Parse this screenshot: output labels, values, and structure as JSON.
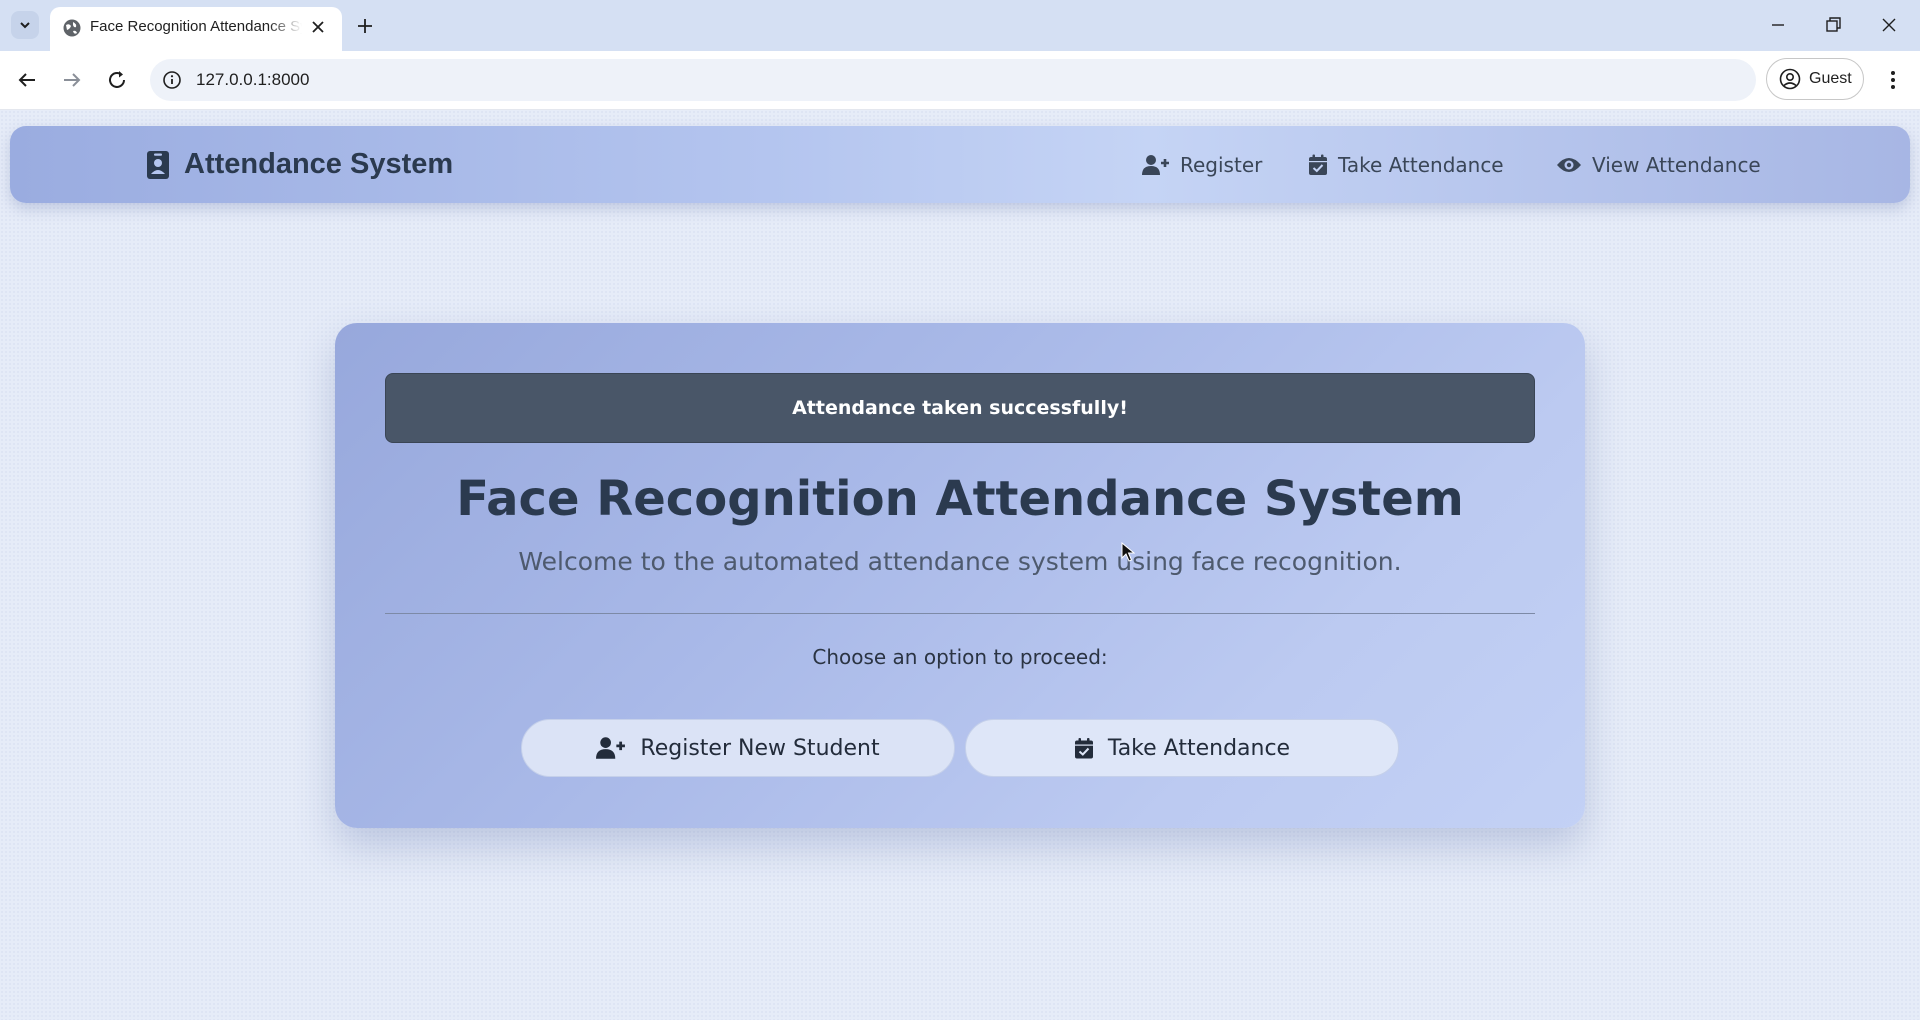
{
  "browser": {
    "tab": {
      "title": "Face Recognition Attendance System"
    },
    "address": {
      "url": "127.0.0.1:8000"
    },
    "profile": {
      "label": "Guest"
    }
  },
  "navbar": {
    "brand": {
      "title": "Attendance System",
      "icon": "id-badge-icon"
    },
    "links": [
      {
        "label": "Register",
        "icon": "user-plus-icon"
      },
      {
        "label": "Take Attendance",
        "icon": "calendar-check-icon"
      },
      {
        "label": "View Attendance",
        "icon": "eye-icon"
      }
    ]
  },
  "main": {
    "alert": "Attendance taken successfully!",
    "title": "Face Recognition Attendance System",
    "subtitle": "Welcome to the automated attendance system using face recognition.",
    "prompt": "Choose an option to proceed:",
    "buttons": [
      {
        "label": "Register New Student",
        "icon": "user-plus-icon"
      },
      {
        "label": "Take Attendance",
        "icon": "calendar-check-icon"
      }
    ]
  },
  "colors": {
    "alert_bg": "#495668",
    "heading": "#2b3a4f",
    "card_gradient_start": "#97a8dc",
    "card_gradient_end": "#c3d1f5"
  }
}
